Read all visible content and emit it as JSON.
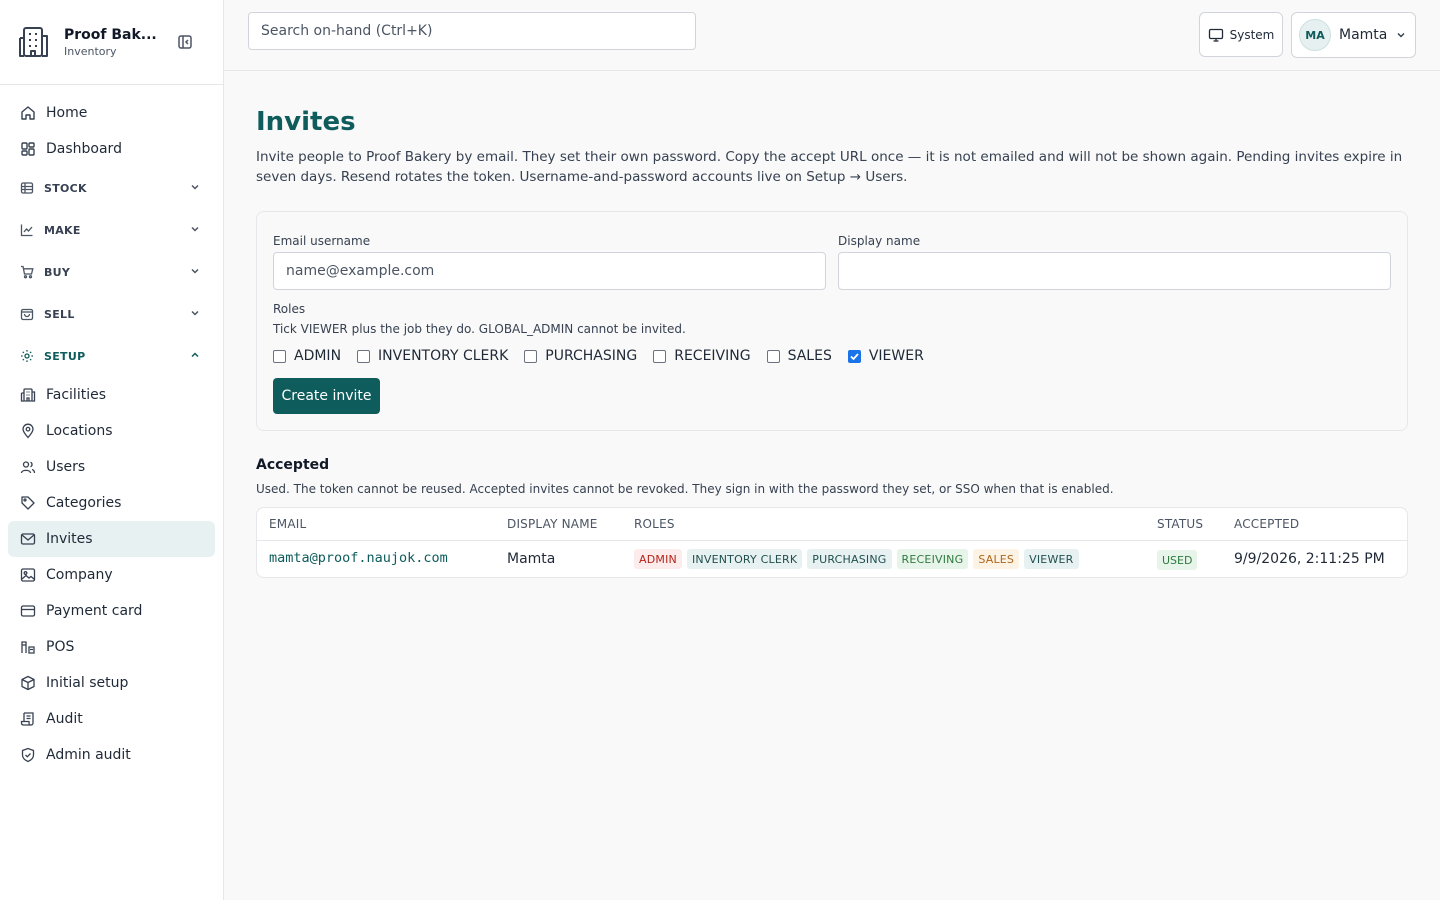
{
  "brand": {
    "name": "Proof Bak...",
    "subtitle": "Inventory",
    "icon": "building-icon"
  },
  "search": {
    "placeholder": "Search on-hand (Ctrl+K)"
  },
  "topbar": {
    "theme_label": "System",
    "user_initials": "MA",
    "user_name": "Mamta"
  },
  "sidebar": {
    "items": [
      {
        "label": "Home",
        "icon": "home-icon"
      },
      {
        "label": "Dashboard",
        "icon": "dashboard-icon"
      }
    ],
    "sections": [
      {
        "label": "STOCK",
        "icon": "stock-icon",
        "open": false
      },
      {
        "label": "MAKE",
        "icon": "chart-icon",
        "open": false
      },
      {
        "label": "BUY",
        "icon": "cart-icon",
        "open": false
      },
      {
        "label": "SELL",
        "icon": "bag-icon",
        "open": false
      },
      {
        "label": "SETUP",
        "icon": "gear-icon",
        "open": true
      }
    ],
    "setup_items": [
      {
        "label": "Facilities",
        "icon": "building-icon"
      },
      {
        "label": "Locations",
        "icon": "pin-icon"
      },
      {
        "label": "Users",
        "icon": "users-icon"
      },
      {
        "label": "Categories",
        "icon": "tag-icon"
      },
      {
        "label": "Invites",
        "icon": "mail-icon",
        "active": true
      },
      {
        "label": "Company",
        "icon": "image-icon"
      },
      {
        "label": "Payment card",
        "icon": "card-icon"
      },
      {
        "label": "POS",
        "icon": "pos-icon"
      },
      {
        "label": "Initial setup",
        "icon": "box-icon"
      },
      {
        "label": "Audit",
        "icon": "scroll-icon"
      },
      {
        "label": "Admin audit",
        "icon": "shield-icon"
      }
    ]
  },
  "page": {
    "title": "Invites",
    "description": "Invite people to Proof Bakery by email. They set their own password. Copy the accept URL once — it is not emailed and will not be shown again. Pending invites expire in seven days. Resend rotates the token. Username-and-password accounts live on Setup → Users."
  },
  "form": {
    "email_label": "Email username",
    "email_placeholder": "name@example.com",
    "email_value": "",
    "display_label": "Display name",
    "display_value": "",
    "roles_label": "Roles",
    "roles_hint": "Tick VIEWER plus the job they do. GLOBAL_ADMIN cannot be invited.",
    "roles": [
      {
        "label": "ADMIN",
        "checked": false
      },
      {
        "label": "INVENTORY CLERK",
        "checked": false
      },
      {
        "label": "PURCHASING",
        "checked": false
      },
      {
        "label": "RECEIVING",
        "checked": false
      },
      {
        "label": "SALES",
        "checked": false
      },
      {
        "label": "VIEWER",
        "checked": true
      }
    ],
    "submit_label": "Create invite"
  },
  "accepted": {
    "title": "Accepted",
    "description": "Used. The token cannot be reused. Accepted invites cannot be revoked. They sign in with the password they set, or SSO when that is enabled.",
    "columns": [
      "EMAIL",
      "DISPLAY NAME",
      "ROLES",
      "STATUS",
      "ACCEPTED"
    ],
    "rows": [
      {
        "email": "mamta@proof.naujok.com",
        "display_name": "Mamta",
        "roles": [
          {
            "label": "ADMIN",
            "bg": "#fdecec",
            "fg": "#b42318"
          },
          {
            "label": "INVENTORY CLERK",
            "bg": "#e8f1f1",
            "fg": "#1f4f4f"
          },
          {
            "label": "PURCHASING",
            "bg": "#e8f1f1",
            "fg": "#1f4f4f"
          },
          {
            "label": "RECEIVING",
            "bg": "#e7f4ea",
            "fg": "#2f7a3d"
          },
          {
            "label": "SALES",
            "bg": "#fdf3e4",
            "fg": "#b0651a"
          },
          {
            "label": "VIEWER",
            "bg": "#e8f1f1",
            "fg": "#1f4f4f"
          }
        ],
        "status": "USED",
        "status_bg": "#e7f4ea",
        "status_fg": "#2f7a3d",
        "accepted_at": "9/9/2026, 2:11:25 PM"
      }
    ]
  },
  "colors": {
    "accent": "#0f5c5c",
    "active_bg": "#e7f1f1",
    "checkbox": "#1a73e8"
  }
}
